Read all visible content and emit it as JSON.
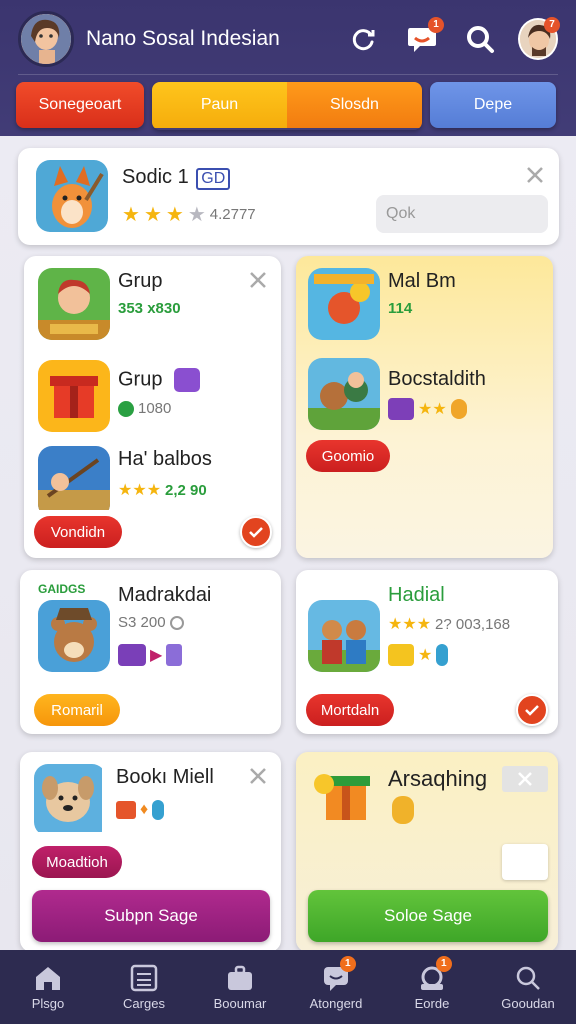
{
  "app": {
    "title": "Nano Sosal Indesian",
    "header_badges": {
      "chat": "1",
      "profile": "7"
    }
  },
  "tabs": [
    {
      "label": "Sonegeoart",
      "color": "#e0331f"
    },
    {
      "label": "Paun",
      "color": "#fdb916"
    },
    {
      "label": "Slosdn",
      "color": "#f98717"
    },
    {
      "label": "Depe",
      "color": "#6089df"
    }
  ],
  "featured": {
    "name": "Sodic 1",
    "tag": "GD",
    "rating_value": "4.2777",
    "search_placeholder": "Qok",
    "rating": 3.5
  },
  "cards": {
    "left_group": {
      "items": [
        {
          "name": "Grup",
          "meta": "353 x830"
        },
        {
          "name": "Grup",
          "meta": "1080"
        },
        {
          "name": "Ha' balbos",
          "meta": "2,2 90"
        }
      ],
      "button": "Vondidn"
    },
    "right_group": {
      "items": [
        {
          "name": "Mal Bm",
          "meta": "114"
        },
        {
          "name": "Bocstaldith",
          "meta": ""
        }
      ],
      "button": "Goomio"
    },
    "mid_left": {
      "name": "Madrakdai",
      "meta": "S3 200",
      "button": "Romaril",
      "banner": "GAIDGS"
    },
    "mid_right": {
      "name": "Hadial",
      "meta": "2? 003,168",
      "button": "Mortdaln"
    },
    "bottom_left": {
      "name": "Bookı Miell",
      "button_small": "Moadtioh",
      "button_big": "Subpn Sage"
    },
    "bottom_right": {
      "name": "Arsaqhing",
      "button_big": "Soloe Sage"
    }
  },
  "bottom_nav": [
    {
      "label": "Plsgo",
      "icon": "home-icon"
    },
    {
      "label": "Carges",
      "icon": "calculator-icon"
    },
    {
      "label": "Booumar",
      "icon": "briefcase-icon"
    },
    {
      "label": "Atongerd",
      "icon": "chat-icon",
      "badge": "1"
    },
    {
      "label": "Eorde",
      "icon": "cart-icon",
      "badge": "1"
    },
    {
      "label": "Gooudan",
      "icon": "search-icon"
    }
  ]
}
